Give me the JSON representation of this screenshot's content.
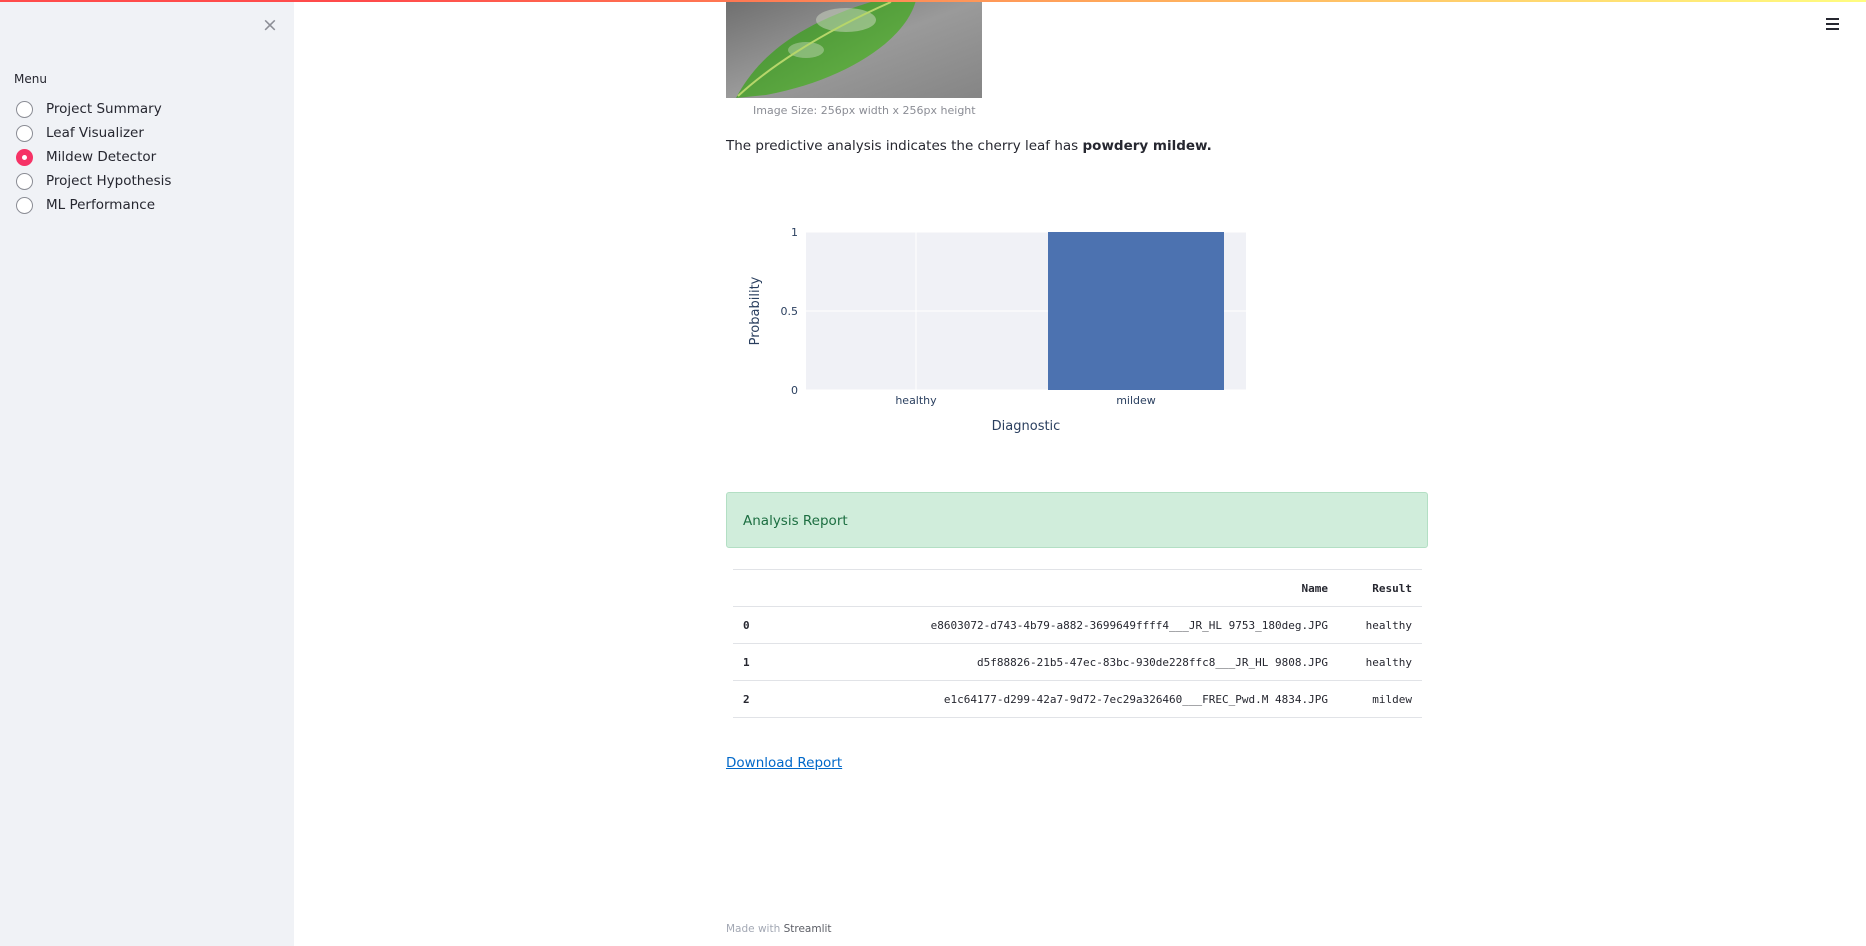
{
  "sidebar": {
    "close_label": "×",
    "menu_label": "Menu",
    "items": [
      {
        "label": "Project Summary",
        "selected": false
      },
      {
        "label": "Leaf Visualizer",
        "selected": false
      },
      {
        "label": "Mildew Detector",
        "selected": true
      },
      {
        "label": "Project Hypothesis",
        "selected": false
      },
      {
        "label": "ML Performance",
        "selected": false
      }
    ]
  },
  "main": {
    "image_caption": "Image Size: 256px width x 256px height",
    "prediction_prefix": "The predictive analysis indicates the cherry leaf has ",
    "prediction_result": "powdery mildew.",
    "alert_text": "Analysis Report",
    "download_label": "Download Report"
  },
  "chart_data": {
    "type": "bar",
    "categories": [
      "healthy",
      "mildew"
    ],
    "values": [
      0,
      1
    ],
    "xlabel": "Diagnostic",
    "ylabel": "Probability",
    "ylim": [
      0,
      1
    ],
    "yticks": [
      "0",
      "0.5",
      "1"
    ],
    "bar_color": "#4c72b0",
    "grid": true
  },
  "table": {
    "headers": [
      "",
      "Name",
      "Result"
    ],
    "rows": [
      {
        "index": "0",
        "name": "e8603072-d743-4b79-a882-3699649ffff4___JR_HL 9753_180deg.JPG",
        "result": "healthy"
      },
      {
        "index": "1",
        "name": "d5f88826-21b5-47ec-83bc-930de228ffc8___JR_HL 9808.JPG",
        "result": "healthy"
      },
      {
        "index": "2",
        "name": "e1c64177-d299-42a7-9d72-7ec29a326460___FREC_Pwd.M 4834.JPG",
        "result": "mildew"
      }
    ]
  },
  "footer": {
    "prefix": "Made with ",
    "brand": "Streamlit"
  },
  "colors": {
    "accent": "#f63366",
    "success_bg": "#d0eddb",
    "link": "#0068c9"
  }
}
